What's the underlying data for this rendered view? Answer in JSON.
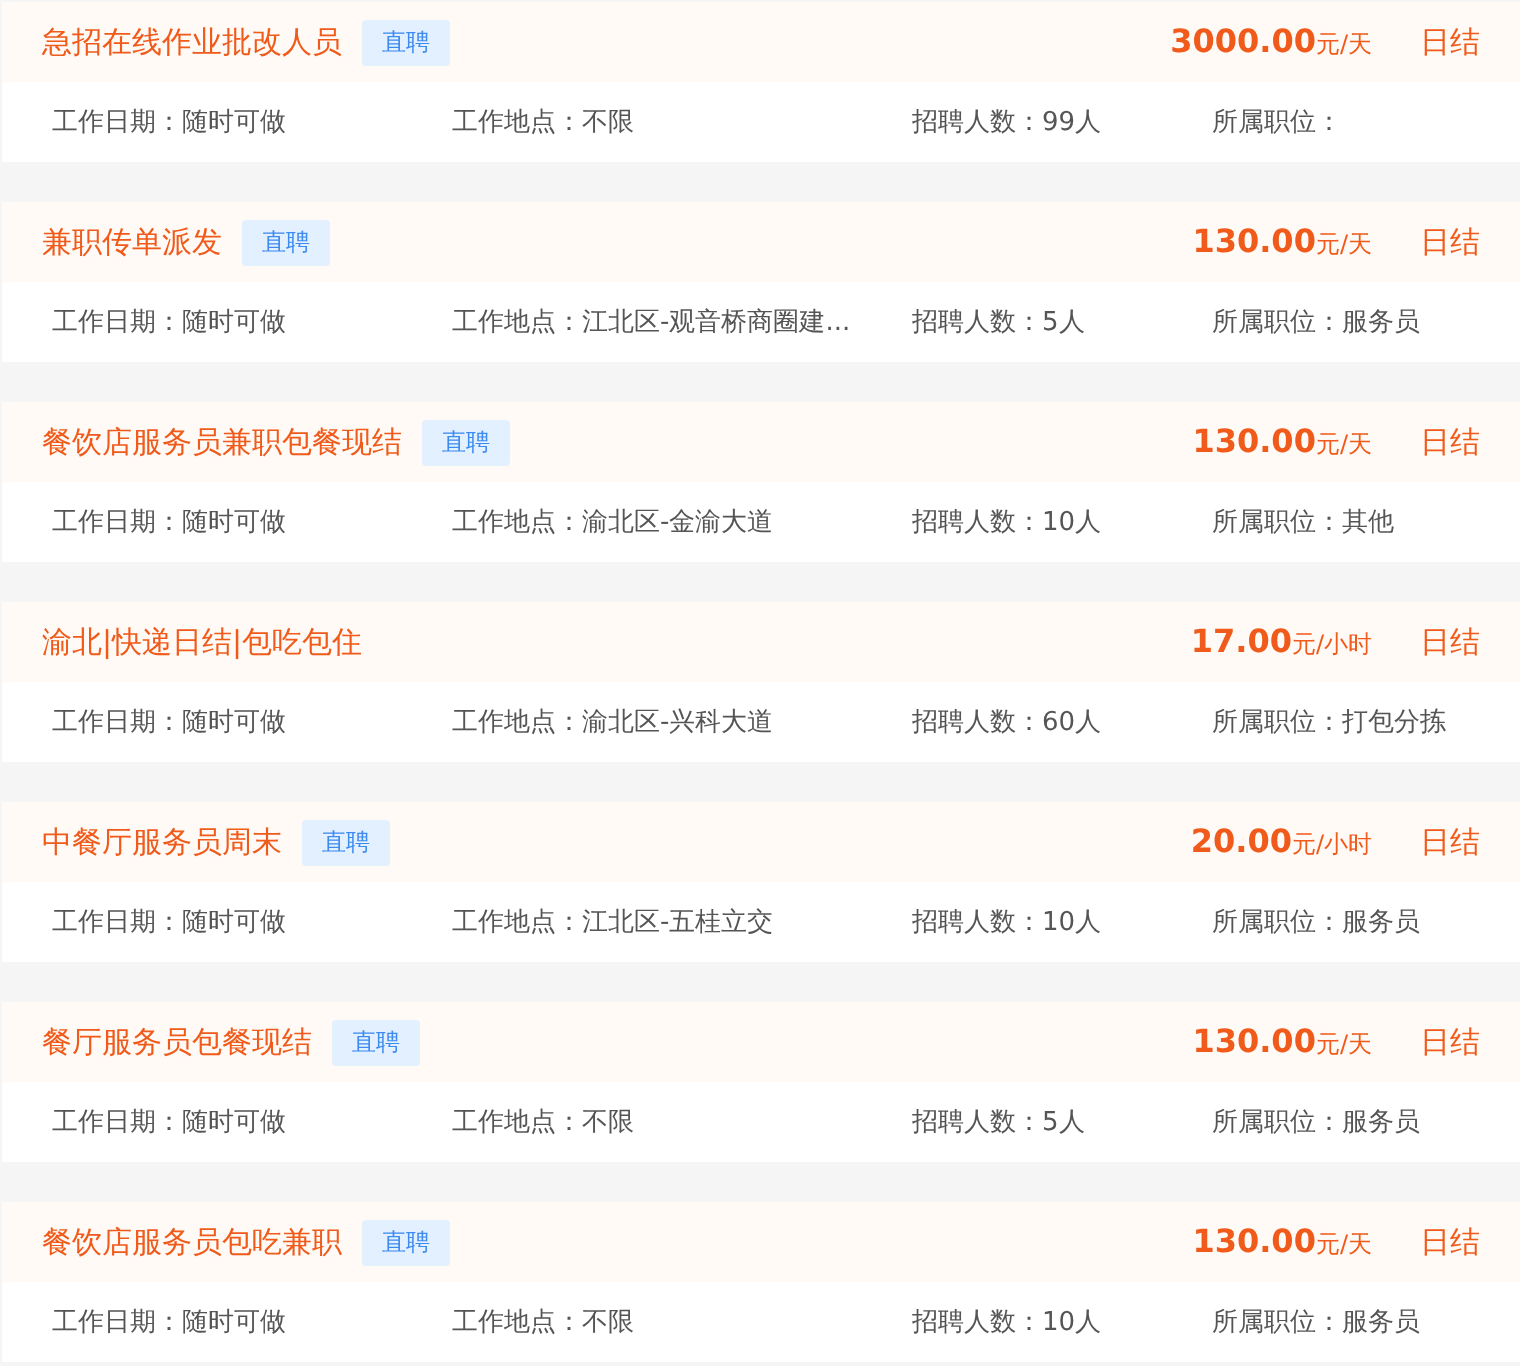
{
  "jobs": [
    {
      "title": "急招在线作业批改人员",
      "tag": "直聘",
      "price": "3000.00",
      "unit": "元/天",
      "settle": "日结",
      "date": "工作日期：随时可做",
      "place": "工作地点：不限",
      "count": "招聘人数：99人",
      "position": "所属职位："
    },
    {
      "title": "兼职传单派发",
      "tag": "直聘",
      "price": "130.00",
      "unit": "元/天",
      "settle": "日结",
      "date": "工作日期：随时可做",
      "place": "工作地点：江北区-观音桥商圈建...",
      "count": "招聘人数：5人",
      "position": "所属职位：服务员"
    },
    {
      "title": "餐饮店服务员兼职包餐现结",
      "tag": "直聘",
      "price": "130.00",
      "unit": "元/天",
      "settle": "日结",
      "date": "工作日期：随时可做",
      "place": "工作地点：渝北区-金渝大道",
      "count": "招聘人数：10人",
      "position": "所属职位：其他"
    },
    {
      "title": "渝北|快递日结|包吃包住",
      "price": "17.00",
      "unit": "元/小时",
      "settle": "日结",
      "date": "工作日期：随时可做",
      "place": "工作地点：渝北区-兴科大道",
      "count": "招聘人数：60人",
      "position": "所属职位：打包分拣"
    },
    {
      "title": "中餐厅服务员周末",
      "tag": "直聘",
      "price": "20.00",
      "unit": "元/小时",
      "settle": "日结",
      "date": "工作日期：随时可做",
      "place": "工作地点：江北区-五桂立交",
      "count": "招聘人数：10人",
      "position": "所属职位：服务员"
    },
    {
      "title": "餐厅服务员包餐现结",
      "tag": "直聘",
      "price": "130.00",
      "unit": "元/天",
      "settle": "日结",
      "date": "工作日期：随时可做",
      "place": "工作地点：不限",
      "count": "招聘人数：5人",
      "position": "所属职位：服务员"
    },
    {
      "title": "餐饮店服务员包吃兼职",
      "tag": "直聘",
      "price": "130.00",
      "unit": "元/天",
      "settle": "日结",
      "date": "工作日期：随时可做",
      "place": "工作地点：不限",
      "count": "招聘人数：10人",
      "position": "所属职位：服务员"
    }
  ]
}
